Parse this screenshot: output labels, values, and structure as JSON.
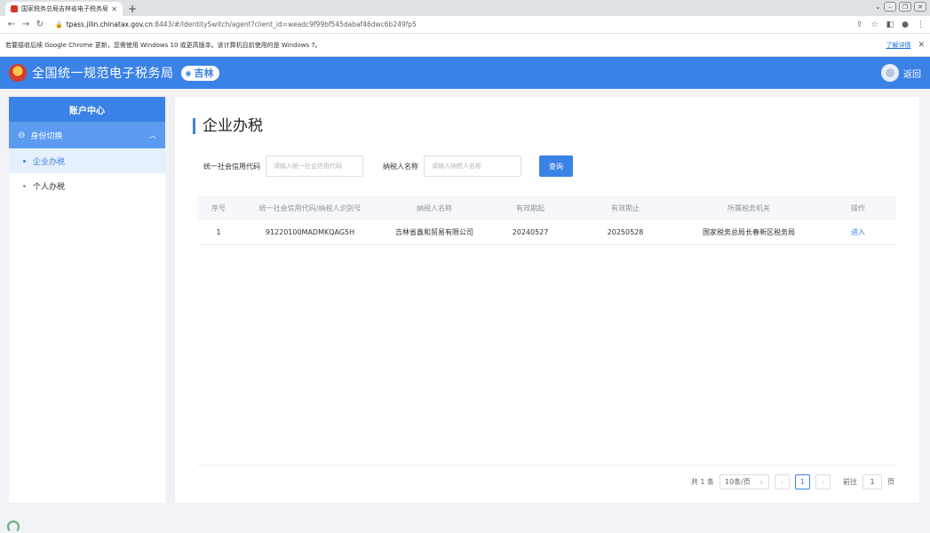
{
  "browser": {
    "tab_title": "国家税务总局吉林省电子税务局",
    "new_tab": "+",
    "url_host": "tpass.jilin.chinatax.gov.cn",
    "url_rest": ":8443/#/IdentitySwitch/agent?client_id=weadc9f99bf545dabaf46dwc6b249fp5",
    "infobar_text": "若要接收后续 Google Chrome 更新，您需使用 Windows 10 或更高版本。该计算机目前使用的是 Windows 7。",
    "infobar_link": "了解详情"
  },
  "header": {
    "title": "全国统一规范电子税务局",
    "region": "吉林",
    "back": "返回"
  },
  "sidebar": {
    "title": "账户中心",
    "group": "身份切换",
    "items": [
      {
        "label": "企业办税",
        "active": true
      },
      {
        "label": "个人办税",
        "active": false
      }
    ]
  },
  "main": {
    "page_title": "企业办税",
    "search": {
      "credit_code_label": "统一社会信用代码",
      "credit_code_placeholder": "请输入统一社会信用代码",
      "taxpayer_label": "纳税人名称",
      "taxpayer_placeholder": "请输入纳税人名称",
      "query_button": "查询"
    },
    "table": {
      "headers": [
        "序号",
        "统一社会信用代码/纳税人识别号",
        "纳税人名称",
        "有效期起",
        "有效期止",
        "所属税务机关",
        "操作"
      ],
      "rows": [
        [
          "1",
          "91220100MADMKQAG5H",
          "吉林省鑫和贸易有限公司",
          "20240527",
          "20250528",
          "国家税务总局长春新区税务局",
          "进入"
        ]
      ]
    },
    "pagination": {
      "total": "共 1 条",
      "page_size": "10条/页",
      "current_page": "1",
      "goto_label": "前往",
      "goto_value": "1",
      "page_suffix": "页"
    }
  },
  "colors": {
    "primary": "#3b82e6",
    "sidebar_group": "#5b9bf0"
  }
}
